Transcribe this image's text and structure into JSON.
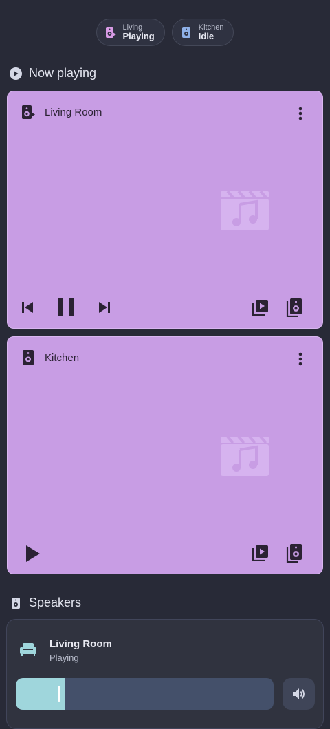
{
  "chips": [
    {
      "room": "Living",
      "state": "Playing",
      "icon": "speaker-playing-icon",
      "color": "#d99ce6"
    },
    {
      "room": "Kitchen",
      "state": "Idle",
      "icon": "speaker-icon",
      "color": "#8fb1e8"
    }
  ],
  "now_playing": {
    "title": "Now playing",
    "players": [
      {
        "name": "Living Room",
        "state": "playing"
      },
      {
        "name": "Kitchen",
        "state": "idle"
      }
    ]
  },
  "speakers": {
    "title": "Speakers",
    "items": [
      {
        "name": "Living Room",
        "status": "Playing",
        "volume": 0.19
      }
    ]
  },
  "colors": {
    "background": "#282a37",
    "card": "#c89de4",
    "slider_fill": "#9fd6dc"
  }
}
